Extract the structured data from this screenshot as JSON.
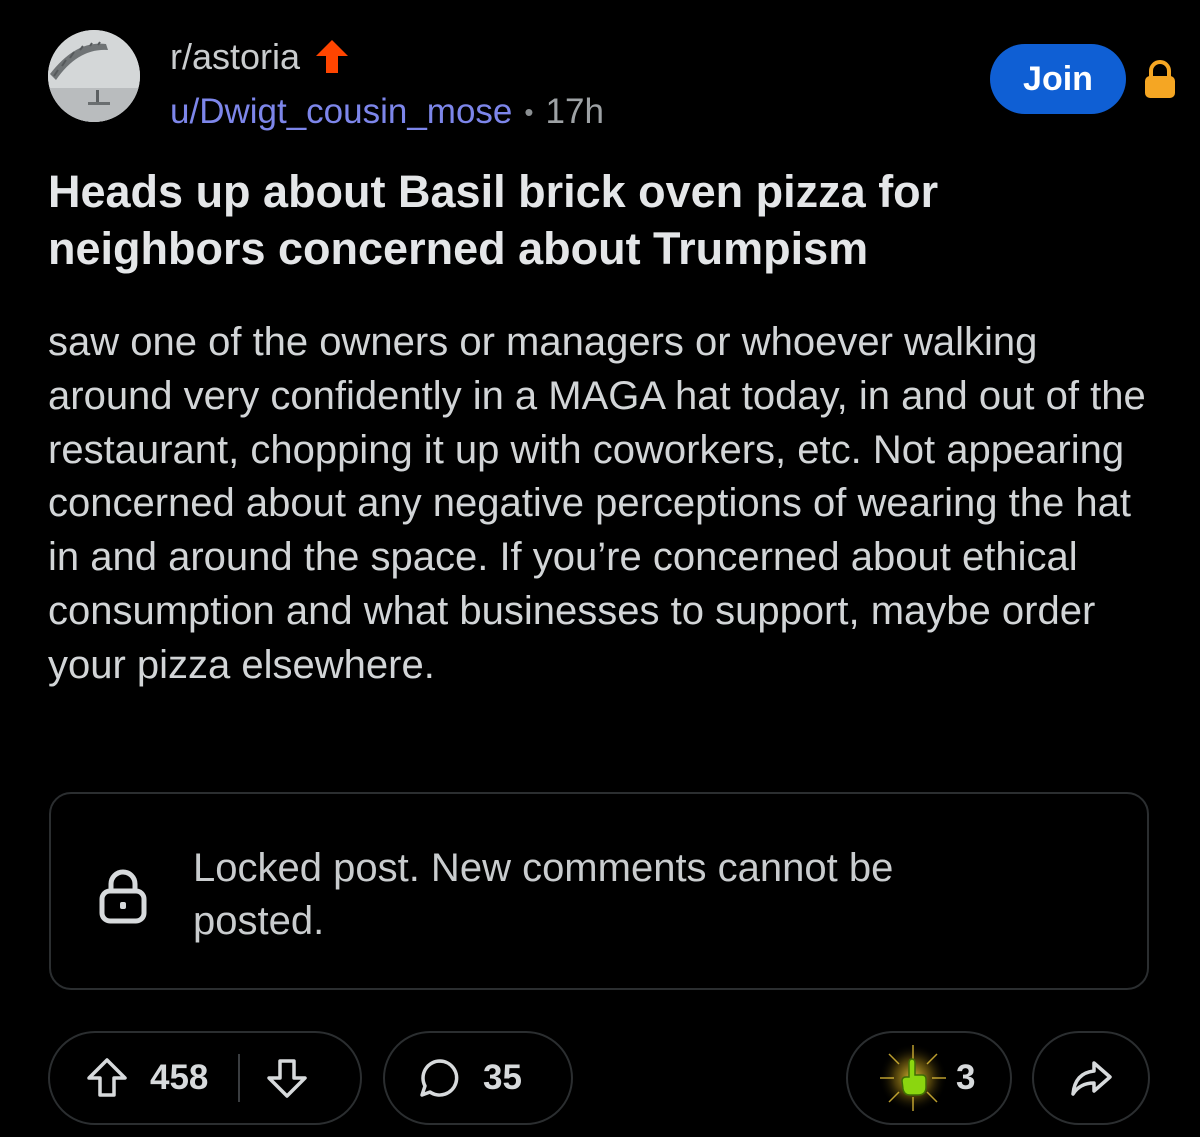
{
  "header": {
    "subreddit": "r/astoria",
    "username": "u/Dwigt_cousin_mose",
    "separator": "•",
    "time": "17h",
    "join_label": "Join"
  },
  "post": {
    "title": "Heads up about Basil brick oven pizza for neighbors concerned about Trumpism",
    "body": "saw one of the owners or managers or whoever walking around very confidently in a MAGA hat today, in and out of the restaurant, chopping it up with coworkers, etc. Not appearing concerned about any negative perceptions of wearing the hat in and around the space. If you’re concerned about ethical consumption and what businesses to support, maybe order your pizza elsewhere."
  },
  "locked_notice": {
    "text": "Locked post. New comments cannot be posted."
  },
  "actions": {
    "upvotes": "458",
    "comments": "35",
    "awards": "3"
  },
  "icons": {
    "trending": "trending-up-icon",
    "lock": "lock-icon",
    "upvote": "upvote-arrow-icon",
    "downvote": "downvote-arrow-icon",
    "comment": "comment-bubble-icon",
    "award": "pointing-hand-award-icon",
    "share": "share-arrow-icon"
  },
  "colors": {
    "background": "#000000",
    "join_button": "#0f5fd4",
    "trend_arrow": "#ff4500",
    "header_lock": "#f5a623",
    "username": "#7d86ea",
    "award_green": "#8bd60f"
  }
}
